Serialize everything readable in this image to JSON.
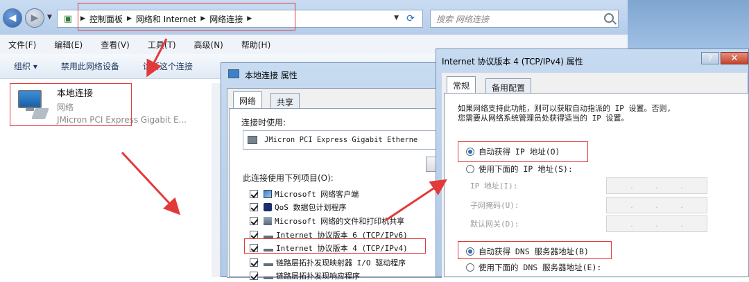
{
  "explorer": {
    "breadcrumb": [
      "控制面板",
      "网络和 Internet",
      "网络连接"
    ],
    "search_placeholder": "搜索 网络连接",
    "menu": [
      "文件(F)",
      "编辑(E)",
      "查看(V)",
      "工具(T)",
      "高级(N)",
      "帮助(H)"
    ],
    "toolbar": [
      "组织 ▾",
      "禁用此网络设备",
      "诊断这个连接"
    ],
    "connection": {
      "name": "本地连接",
      "network": "网络",
      "device": "JMicron PCI Express Gigabit E..."
    }
  },
  "dialog1": {
    "title": "本地连接 属性",
    "tabs": [
      "网络",
      "共享"
    ],
    "connect_using_label": "连接时使用:",
    "device": "JMicron PCI Express Gigabit Etherne",
    "items_label": "此连接使用下列项目(O):",
    "items": [
      {
        "label": "Microsoft 网络客户端",
        "checked": true,
        "icon": "client-icon"
      },
      {
        "label": "QoS 数据包计划程序",
        "checked": true,
        "icon": "qos-icon"
      },
      {
        "label": "Microsoft 网络的文件和打印机共享",
        "checked": true,
        "icon": "share-icon"
      },
      {
        "label": "Internet 协议版本 6 (TCP/IPv6)",
        "checked": true,
        "icon": "protocol-icon"
      },
      {
        "label": "Internet 协议版本 4 (TCP/IPv4)",
        "checked": true,
        "icon": "protocol-icon"
      },
      {
        "label": "链路层拓扑发现映射器 I/O 驱动程序",
        "checked": true,
        "icon": "protocol-icon"
      },
      {
        "label": "链路层拓扑发现响应程序",
        "checked": true,
        "icon": "protocol-icon"
      }
    ]
  },
  "dialog2": {
    "title": "Internet 协议版本 4 (TCP/IPv4) 属性",
    "help": "?",
    "close": "✕",
    "tabs": [
      "常规",
      "备用配置"
    ],
    "description_line1": "如果网络支持此功能，则可以获取自动指派的 IP 设置。否则,",
    "description_line2": "您需要从网络系统管理员处获得适当的 IP 设置。",
    "auto_ip": "自动获得 IP 地址(O)",
    "manual_ip": "使用下面的 IP 地址(S):",
    "ip_label": "IP 地址(I):",
    "mask_label": "子网掩码(U):",
    "gateway_label": "默认网关(D):",
    "auto_dns": "自动获得 DNS 服务器地址(B)",
    "manual_dns": "使用下面的 DNS 服务器地址(E):"
  },
  "colors": {
    "highlight": "#e23a3a",
    "title_bar": "#b5cde9"
  }
}
